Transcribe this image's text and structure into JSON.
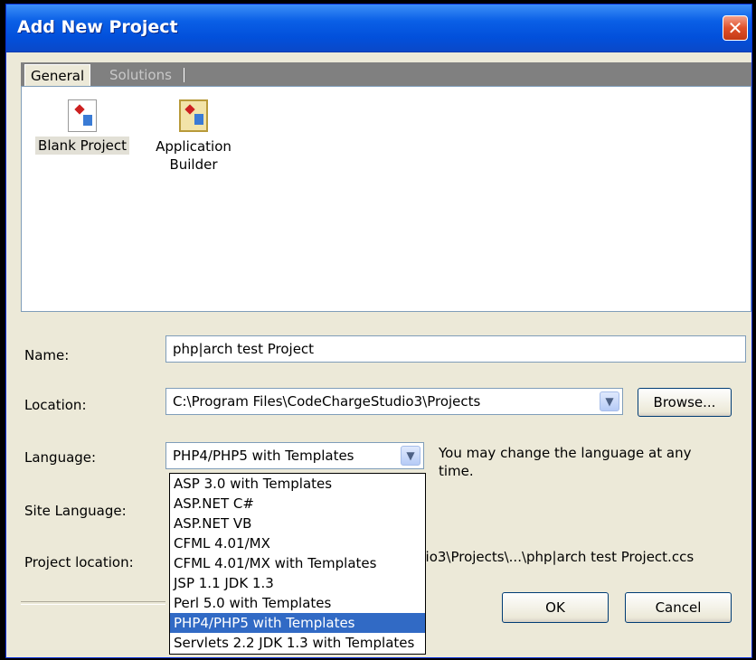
{
  "window": {
    "title": "Add New Project",
    "close_glyph": "✕"
  },
  "tabs": [
    {
      "label": "General"
    },
    {
      "label": "Solutions"
    }
  ],
  "projects": [
    {
      "label_line1": "Blank Project",
      "label_line2": "",
      "icon": "blank-project-icon"
    },
    {
      "label_line1": "Application",
      "label_line2": "Builder",
      "icon": "application-builder-icon"
    }
  ],
  "form": {
    "name_label": "Name:",
    "name_value": "php|arch test Project",
    "location_label": "Location:",
    "location_value": "C:\\Program Files\\CodeChargeStudio3\\Projects",
    "browse_label": "Browse...",
    "language_label": "Language:",
    "language_value": "PHP4/PHP5 with Templates",
    "language_note": "You may change the language at any time.",
    "site_language_label": "Site Language:",
    "project_location_label": "Project location:",
    "project_location_value": "dio3\\Projects\\...\\php|arch test Project.ccs"
  },
  "language_options": [
    "ASP 3.0 with Templates",
    "ASP.NET C#",
    "ASP.NET VB",
    "CFML 4.01/MX",
    "CFML 4.01/MX with Templates",
    "JSP 1.1 JDK 1.3",
    "Perl 5.0 with Templates",
    "PHP4/PHP5 with Templates",
    "Servlets 2.2 JDK 1.3 with Templates"
  ],
  "language_selected_index": 7,
  "buttons": {
    "ok": "OK",
    "cancel": "Cancel"
  },
  "colors": {
    "title_bar": "#0a5fe6",
    "selection": "#316ac5",
    "dialog_bg": "#ece9d8"
  }
}
